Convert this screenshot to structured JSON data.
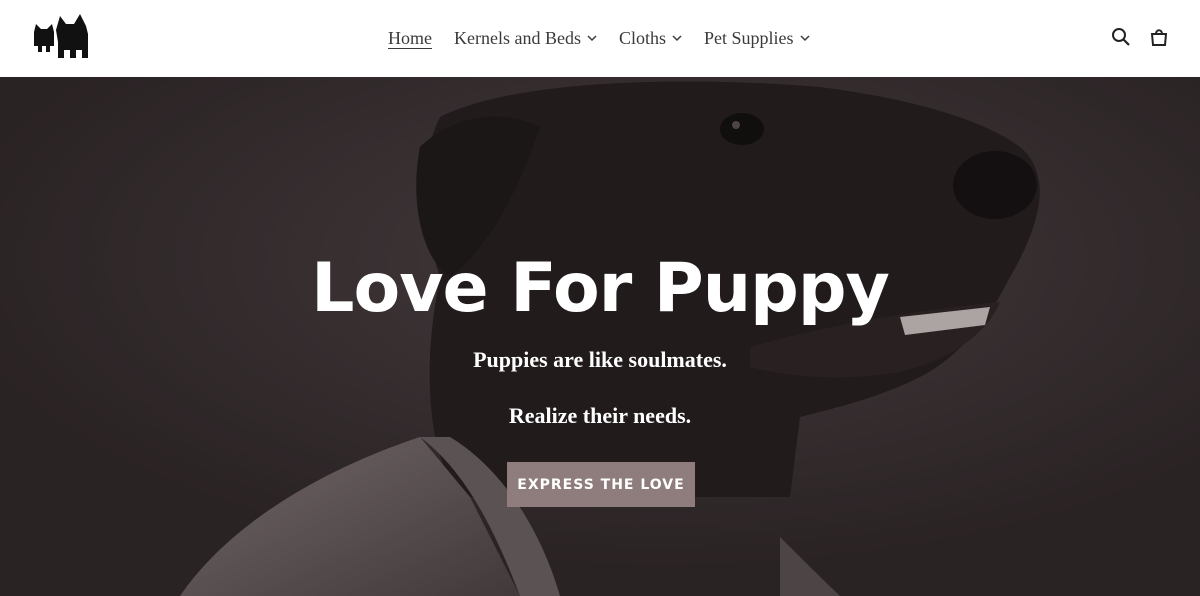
{
  "header": {
    "logo_icon": "cat-and-dog-logo-icon",
    "nav": [
      {
        "label": "Home",
        "active": true,
        "has_dropdown": false
      },
      {
        "label": "Kernels and Beds",
        "active": false,
        "has_dropdown": true
      },
      {
        "label": "Cloths",
        "active": false,
        "has_dropdown": true
      },
      {
        "label": "Pet Supplies",
        "active": false,
        "has_dropdown": true
      }
    ],
    "icons": [
      "search-icon",
      "cart-icon"
    ]
  },
  "hero": {
    "title": "Love For Puppy",
    "subtitle_1": "Puppies are like soulmates.",
    "subtitle_2": "Realize their needs.",
    "cta_label": "EXPRESS THE LOVE",
    "cta_color": "#8f7d7d",
    "image": "black-dog-wearing-jacket-photo"
  }
}
